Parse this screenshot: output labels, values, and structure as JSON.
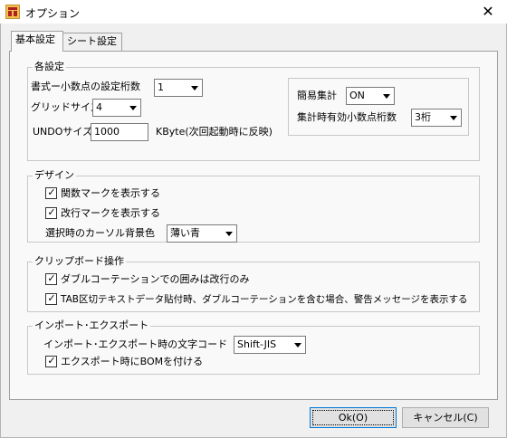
{
  "window": {
    "title": "オプション",
    "close_glyph": "✕"
  },
  "tabs": [
    {
      "label": "基本設定",
      "active": true
    },
    {
      "label": "シート設定",
      "active": false
    }
  ],
  "general": {
    "legend": "各設定",
    "decimal_label": "書式ー小数点の設定桁数",
    "decimal_value": "1",
    "grid_label": "グリッドサイズ",
    "grid_value": "4",
    "undo_label": "UNDOサイズ",
    "undo_value": "1000",
    "undo_unit": "KByte(次回起動時に反映)",
    "simple_label": "簡易集計",
    "simple_value": "ON",
    "sig_label": "集計時有効小数点桁数",
    "sig_value": "3桁"
  },
  "design": {
    "legend": "デザイン",
    "function_mark_label": "関数マークを表示する",
    "function_mark_checked": true,
    "newline_mark_label": "改行マークを表示する",
    "newline_mark_checked": true,
    "cursor_bg_label": "選択時のカーソル背景色",
    "cursor_bg_value": "薄い青"
  },
  "clipboard": {
    "legend": "クリップボード操作",
    "quote_label": "ダブルコーテーションでの囲みは改行のみ",
    "quote_checked": true,
    "warn_label": "TAB区切テキストデータ貼付時、ダブルコーテーションを含む場合、警告メッセージを表示する",
    "warn_checked": true
  },
  "import_export": {
    "legend": "インポート･エクスポート",
    "charset_label": "インポート･エクスポート時の文字コード",
    "charset_value": "Shift-JIS",
    "bom_label": "エクスポート時にBOMを付ける",
    "bom_checked": true
  },
  "buttons": {
    "ok": "Ok(O)",
    "cancel": "キャンセル(C)"
  },
  "colors": {
    "focus_border": "#0078d7",
    "panel_bg": "#f9f9f9",
    "dialog_bg": "#f0f0f0"
  }
}
